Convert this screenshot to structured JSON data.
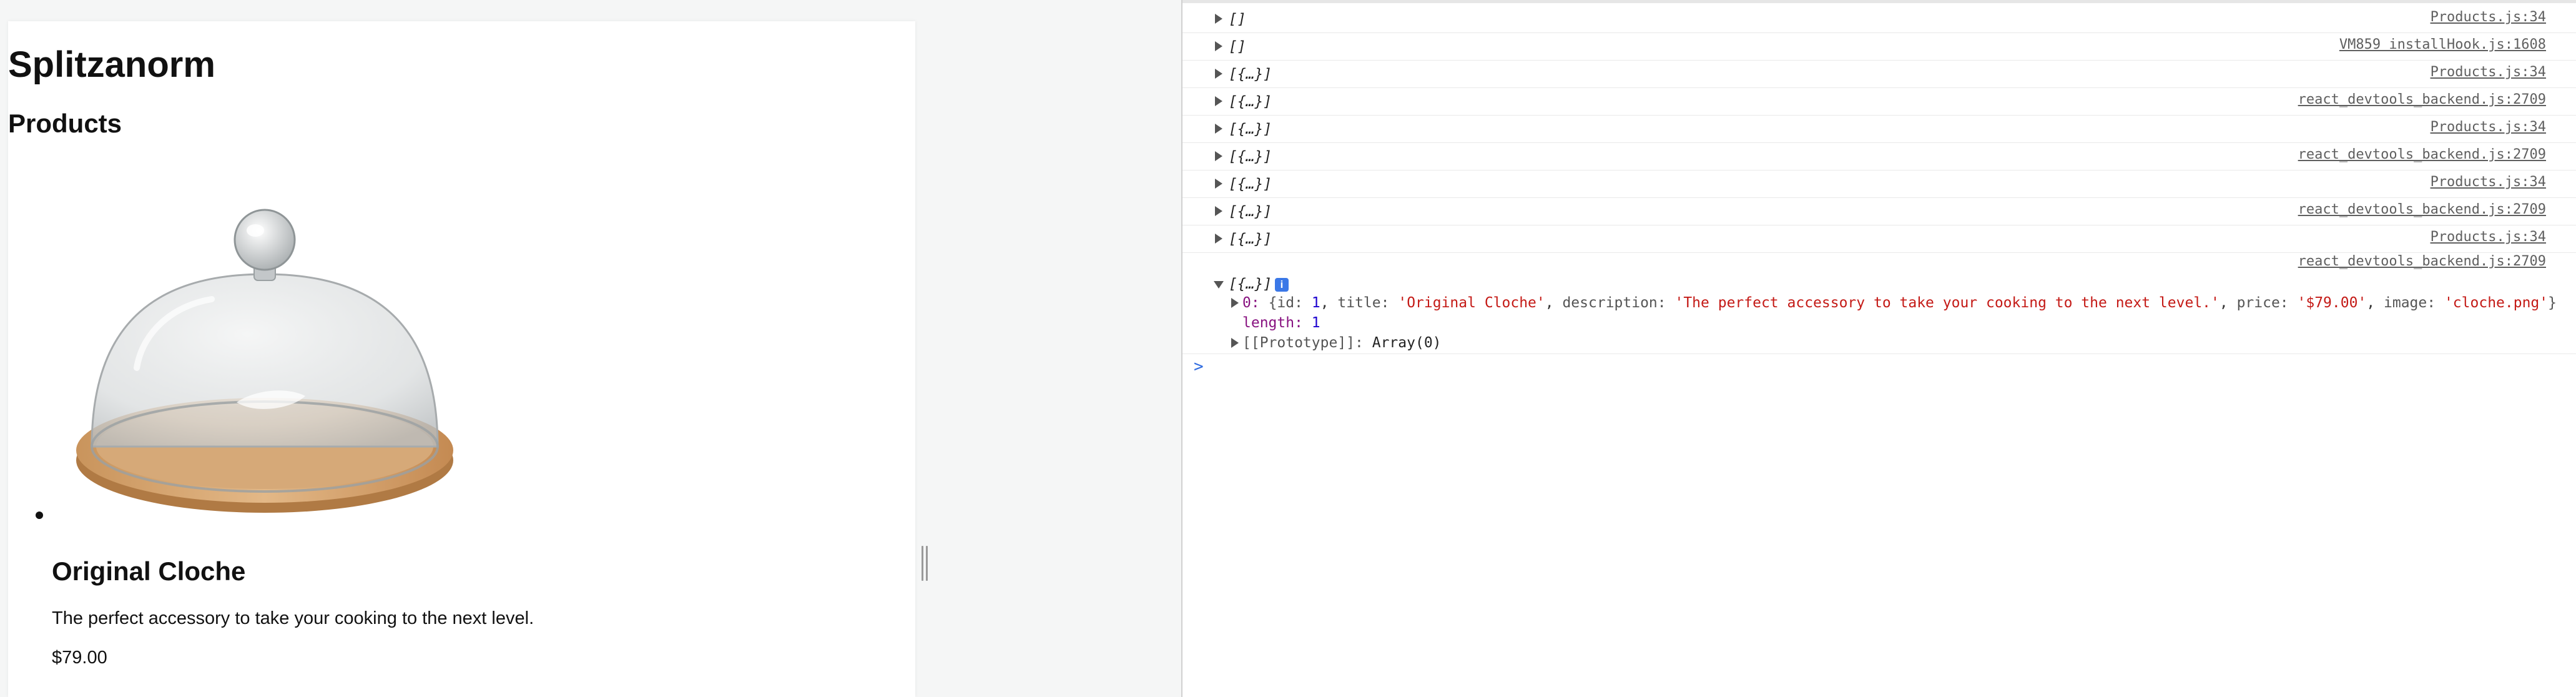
{
  "page": {
    "app_title": "Splitzanorm",
    "section_title": "Products",
    "product": {
      "title": "Original Cloche",
      "description": "The perfect accessory to take your cooking to the next level.",
      "price": "$79.00"
    }
  },
  "console": {
    "rows": [
      {
        "message": "[]",
        "source": "Products.js:34"
      },
      {
        "message": "[]",
        "source": "VM859 installHook.js:1608"
      },
      {
        "message": "[{…}]",
        "source": "Products.js:34"
      },
      {
        "message": "[{…}]",
        "source": "react_devtools_backend.js:2709"
      },
      {
        "message": "[{…}]",
        "source": "Products.js:34"
      },
      {
        "message": "[{…}]",
        "source": "react_devtools_backend.js:2709"
      },
      {
        "message": "[{…}]",
        "source": "Products.js:34"
      },
      {
        "message": "[{…}]",
        "source": "react_devtools_backend.js:2709"
      },
      {
        "message": "[{…}]",
        "source": "Products.js:34"
      }
    ],
    "expanded": {
      "source": "react_devtools_backend.js:2709",
      "message": "[{…}]",
      "info_badge": "i",
      "item_index": "0:",
      "open_brace": "{",
      "id_key": "id:",
      "id_value": "1",
      "title_key": "title:",
      "title_value": "'Original Cloche'",
      "description_key": "description:",
      "description_value": "'The perfect accessory to take your cooking to the next level.'",
      "price_key": "price:",
      "price_value": "'$79.00'",
      "image_key": "image:",
      "image_value": "'cloche.png'",
      "close_brace": "}",
      "length_key": "length:",
      "length_value": "1",
      "prototype_key": "[[Prototype]]:",
      "prototype_value": "Array(0)"
    },
    "prompt_symbol": ">"
  },
  "colors": {
    "console_string": "#c41a16",
    "console_number": "#1c00cf",
    "console_key": "#881280",
    "console_prompt": "#2f6be0",
    "info_badge": "#3b78e7",
    "page_background": "#f5f6f6"
  },
  "icons": [
    "expand-triangle-icon",
    "collapse-triangle-icon",
    "info-badge-icon",
    "console-prompt-icon",
    "resize-handle-icon"
  ]
}
